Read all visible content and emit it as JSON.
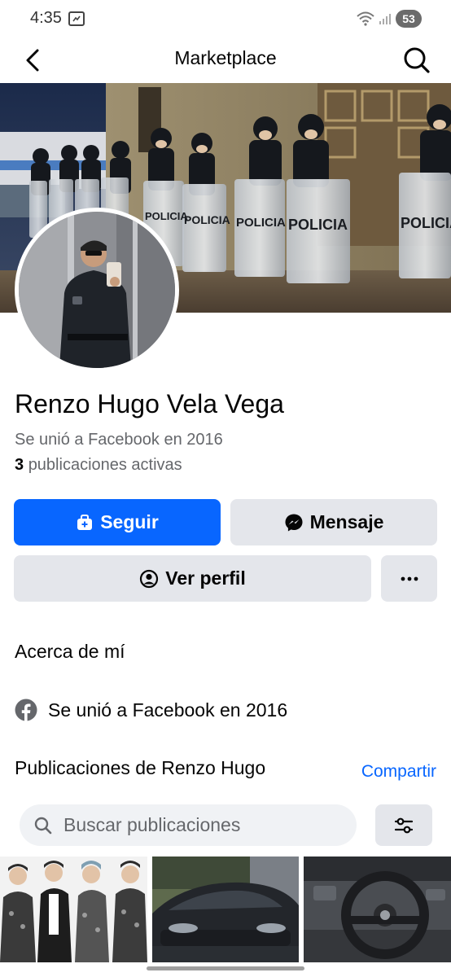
{
  "status_bar": {
    "time": "4:35",
    "battery": "53"
  },
  "nav": {
    "title": "Marketplace",
    "back_icon": "chevron-left-icon",
    "search_icon": "search-icon"
  },
  "cover": {
    "shield_text": "POLICIA"
  },
  "profile": {
    "name": "Renzo Hugo Vela Vega",
    "joined": "Se unió a Facebook en 2016",
    "active_count": "3",
    "active_label": "publicaciones activas"
  },
  "actions": {
    "follow": "Seguir",
    "message": "Mensaje",
    "view_profile": "Ver perfil",
    "more": "···"
  },
  "about": {
    "title": "Acerca de mí",
    "joined": "Se unió a Facebook en 2016"
  },
  "posts": {
    "title": "Publicaciones de Renzo Hugo",
    "share": "Compartir",
    "search_placeholder": "Buscar publicaciones"
  },
  "colors": {
    "accent": "#0866ff",
    "button_gray": "#e4e6eb",
    "secondary_text": "#65676b"
  }
}
